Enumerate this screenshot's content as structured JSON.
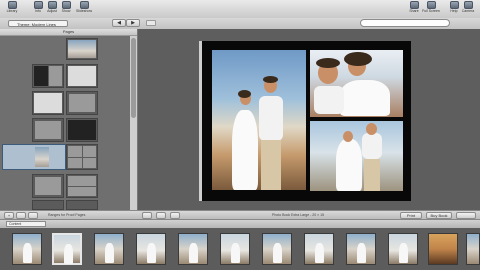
{
  "toolbar": {
    "left_buttons": [
      {
        "label": "Library",
        "icon": "library-icon"
      },
      {
        "label": "Info",
        "icon": "info-icon"
      },
      {
        "label": "Adjust",
        "icon": "adjust-icon"
      },
      {
        "label": "Show",
        "icon": "show-icon"
      },
      {
        "label": "Slideshow",
        "icon": "slideshow-icon"
      }
    ],
    "right_buttons": [
      {
        "label": "Share",
        "icon": "share-icon"
      },
      {
        "label": "Full Screen",
        "icon": "fullscreen-icon"
      },
      {
        "label": "Help",
        "icon": "help-icon"
      },
      {
        "label": "Camera",
        "icon": "camera-icon"
      }
    ]
  },
  "subbar": {
    "theme_selector": "Theme: Modern Lines",
    "prev_label": "◀",
    "next_label": "▶"
  },
  "pages_pane": {
    "header": "Pages"
  },
  "controls": {
    "add_label": "+",
    "page_info": "Ranges for Proof Pages",
    "set_label": "Print",
    "export_label": "Buy Book",
    "status_text": "Photo Book Extra Large - 20 × 15"
  },
  "browser": {
    "selector": "Content"
  },
  "colors": {
    "selection": "#aebfcf",
    "page_background": "#080808",
    "canvas": "#5e5e5e"
  }
}
